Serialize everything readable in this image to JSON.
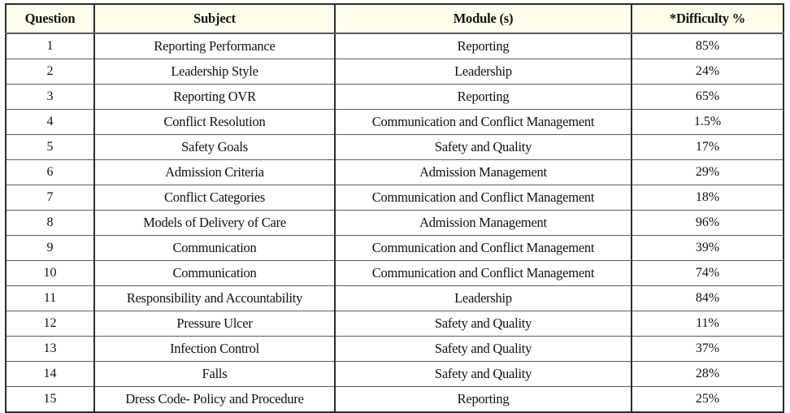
{
  "table": {
    "columns": [
      {
        "key": "question",
        "label": "Question"
      },
      {
        "key": "subject",
        "label": "Subject"
      },
      {
        "key": "module",
        "label": "Module (s)"
      },
      {
        "key": "difficulty",
        "label": "*Difficulty %"
      }
    ],
    "header_background": "#FFFDEB",
    "border_color": "#2B2B2B",
    "grid_line_color": "#5C5C5C",
    "text_color": "#111111",
    "rows": [
      {
        "question": "1",
        "subject": "Reporting Performance",
        "module": "Reporting",
        "difficulty": "85%"
      },
      {
        "question": "2",
        "subject": "Leadership Style",
        "module": "Leadership",
        "difficulty": "24%"
      },
      {
        "question": "3",
        "subject": "Reporting OVR",
        "module": "Reporting",
        "difficulty": "65%"
      },
      {
        "question": "4",
        "subject": "Conflict Resolution",
        "module": "Communication and Conflict Management",
        "difficulty": "1.5%"
      },
      {
        "question": "5",
        "subject": "Safety Goals",
        "module": "Safety and Quality",
        "difficulty": "17%"
      },
      {
        "question": "6",
        "subject": "Admission Criteria",
        "module": "Admission Management",
        "difficulty": "29%"
      },
      {
        "question": "7",
        "subject": "Conflict Categories",
        "module": "Communication and Conflict Management",
        "difficulty": "18%"
      },
      {
        "question": "8",
        "subject": "Models of Delivery of Care",
        "module": "Admission Management",
        "difficulty": "96%"
      },
      {
        "question": "9",
        "subject": "Communication",
        "module": "Communication and Conflict Management",
        "difficulty": "39%"
      },
      {
        "question": "10",
        "subject": "Communication",
        "module": "Communication and Conflict Management",
        "difficulty": "74%"
      },
      {
        "question": "11",
        "subject": "Responsibility and Accountability",
        "module": "Leadership",
        "difficulty": "84%"
      },
      {
        "question": "12",
        "subject": "Pressure Ulcer",
        "module": "Safety and Quality",
        "difficulty": "11%"
      },
      {
        "question": "13",
        "subject": "Infection Control",
        "module": "Safety and Quality",
        "difficulty": "37%"
      },
      {
        "question": "14",
        "subject": "Falls",
        "module": "Safety and Quality",
        "difficulty": "28%"
      },
      {
        "question": "15",
        "subject": "Dress Code- Policy and Procedure",
        "module": "Reporting",
        "difficulty": "25%"
      }
    ]
  }
}
